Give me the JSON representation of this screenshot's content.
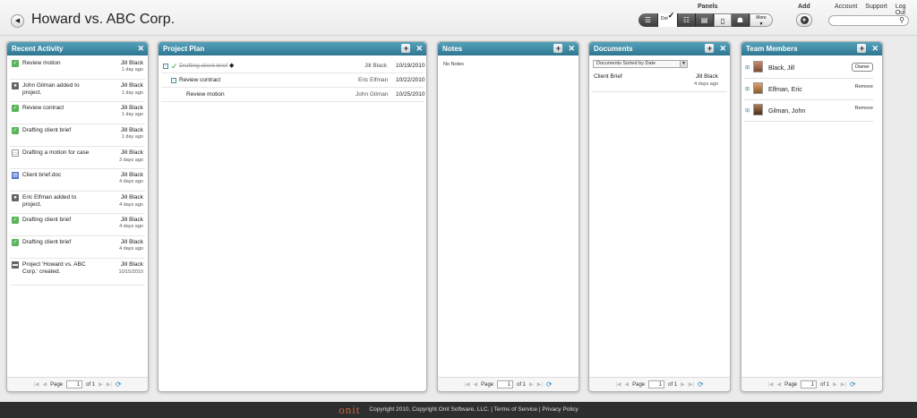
{
  "header": {
    "back_glyph": "◀",
    "title": "Howard vs. ABC Corp.",
    "panels_label": "Panels",
    "add_label": "Add",
    "links": [
      "Account",
      "Support",
      "Log Out"
    ],
    "toolbar": {
      "dot_label": "Dot",
      "more_label": "More"
    }
  },
  "recent_activity": {
    "title": "Recent Activity",
    "items": [
      {
        "icon": "check-icon",
        "text": "Review motion",
        "user": "Jill Black",
        "time": "1 day ago"
      },
      {
        "icon": "person-icon",
        "text": "John Gilman added to project.",
        "user": "Jill Black",
        "time": "1 day ago"
      },
      {
        "icon": "check-icon",
        "text": "Review contract",
        "user": "Jill Black",
        "time": "1 day ago"
      },
      {
        "icon": "check-icon",
        "text": "Drafting client brief",
        "user": "Jill Black",
        "time": "1 day ago"
      },
      {
        "icon": "monitor-icon",
        "text": "Drafting a motion for case",
        "user": "Jill Black",
        "time": "3 days ago"
      },
      {
        "icon": "document-icon",
        "text": "Client brief.doc",
        "user": "Jill Black",
        "time": "4 days ago"
      },
      {
        "icon": "person-icon",
        "text": "Eric Elfman added to project.",
        "user": "Jill Black",
        "time": "4 days ago"
      },
      {
        "icon": "check-icon",
        "text": "Drafting client brief",
        "user": "Jill Black",
        "time": "4 days ago"
      },
      {
        "icon": "check-icon",
        "text": "Drafting client brief",
        "user": "Jill Black",
        "time": "4 days ago"
      },
      {
        "icon": "folder-icon",
        "text": "Project 'Howard vs. ABC Corp.' created.",
        "user": "Jill Black",
        "time": "10/15/2010"
      }
    ],
    "pager": {
      "label": "Page",
      "page": "1",
      "of": "of 1"
    }
  },
  "project_plan": {
    "title": "Project Plan",
    "rows": [
      {
        "name": "Drafting client brief",
        "owner": "Jill Black",
        "date": "10/19/2010"
      },
      {
        "name": "Review contract",
        "owner": "Eric Elfman",
        "date": "10/22/2010"
      },
      {
        "name": "Review motion",
        "owner": "John Gilman",
        "date": "10/25/2010"
      }
    ]
  },
  "notes": {
    "title": "Notes",
    "empty_text": "No Notes",
    "pager": {
      "label": "Page",
      "page": "1",
      "of": "of 1"
    }
  },
  "documents": {
    "title": "Documents",
    "sort_select": "Documents Sorted by Date",
    "items": [
      {
        "name": "Client Brief",
        "user": "Jill Black",
        "time": "4 days ago"
      }
    ],
    "pager": {
      "label": "Page",
      "page": "1",
      "of": "of 1"
    }
  },
  "team_members": {
    "title": "Team Members",
    "members": [
      {
        "name": "Black, Jill",
        "action": "Owner"
      },
      {
        "name": "Elfman, Eric",
        "action": "Remove"
      },
      {
        "name": "Gilman, John",
        "action": "Remove"
      }
    ],
    "pager": {
      "label": "Page",
      "page": "1",
      "of": "of 1"
    }
  },
  "footer": {
    "logo": "onit",
    "text": "Copyright 2010, Copyright Onit Software, LLC. | Terms of Service | Privacy Policy"
  }
}
